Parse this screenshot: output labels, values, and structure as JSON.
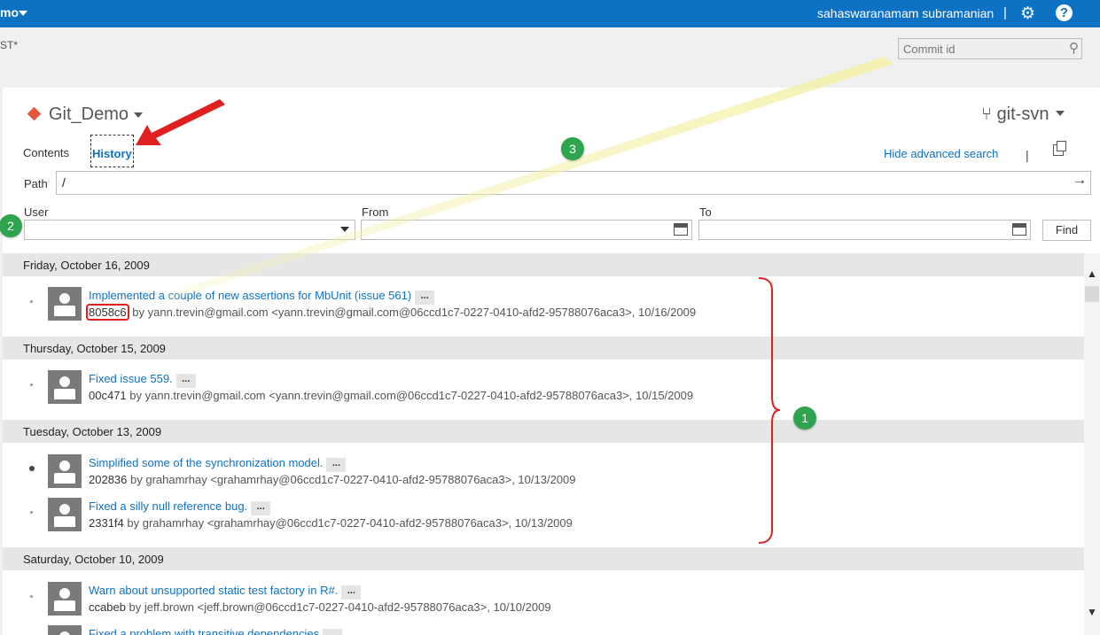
{
  "topbar": {
    "project": "mo",
    "user": "sahaswaranamam subramanian",
    "separator": "|",
    "gear_glyph": "⚙",
    "help_glyph": "?"
  },
  "breadcrumb": "ST*",
  "commit_search": {
    "placeholder": "Commit id",
    "icon": "search-icon"
  },
  "repo": {
    "name": "Git_Demo",
    "branch": "git-svn"
  },
  "tabs": {
    "contents": "Contents",
    "history": "History"
  },
  "links": {
    "hide_advanced": "Hide advanced search",
    "separator": "|"
  },
  "path": {
    "label": "Path",
    "value": "/",
    "go_glyph": "→"
  },
  "filters": {
    "user_label": "User",
    "from_label": "From",
    "to_label": "To",
    "find_label": "Find"
  },
  "days": [
    {
      "label": "Friday, October 16, 2009"
    },
    {
      "label": "Thursday, October 15, 2009"
    },
    {
      "label": "Tuesday, October 13, 2009"
    },
    {
      "label": "Saturday, October 10, 2009"
    }
  ],
  "entries": [
    {
      "message": "Implemented a couple of new assertions for MbUnit (issue 561)",
      "more": "...",
      "hash": "8058c6",
      "details": " by yann.trevin@gmail.com <yann.trevin@gmail.com@06ccd1c7-0227-0410-afd2-95788076aca3>, 10/16/2009"
    },
    {
      "message": "Fixed issue 559.",
      "more": "...",
      "hash": "00c471",
      "details": " by yann.trevin@gmail.com <yann.trevin@gmail.com@06ccd1c7-0227-0410-afd2-95788076aca3>, 10/15/2009"
    },
    {
      "message": "Simplified some of the synchronization model.",
      "more": "...",
      "hash": "202836",
      "details": " by grahamrhay <grahamrhay@06ccd1c7-0227-0410-afd2-95788076aca3>, 10/13/2009"
    },
    {
      "message": "Fixed a silly null reference bug.",
      "more": "...",
      "hash": "2331f4",
      "details": " by grahamrhay <grahamrhay@06ccd1c7-0227-0410-afd2-95788076aca3>, 10/13/2009"
    },
    {
      "message": "Warn about unsupported static test factory in R#.",
      "more": "...",
      "hash": "ccabeb",
      "details": " by jeff.brown <jeff.brown@06ccd1c7-0227-0410-afd2-95788076aca3>, 10/10/2009"
    },
    {
      "message": "Fixed a problem with transitive dependencies",
      "more": "..."
    }
  ],
  "annotations": {
    "badge1": "1",
    "badge2": "2",
    "badge3": "3"
  },
  "colors": {
    "accent": "#0e72c4",
    "annotation_red": "#e02020",
    "badge_green": "#2ea44f"
  }
}
